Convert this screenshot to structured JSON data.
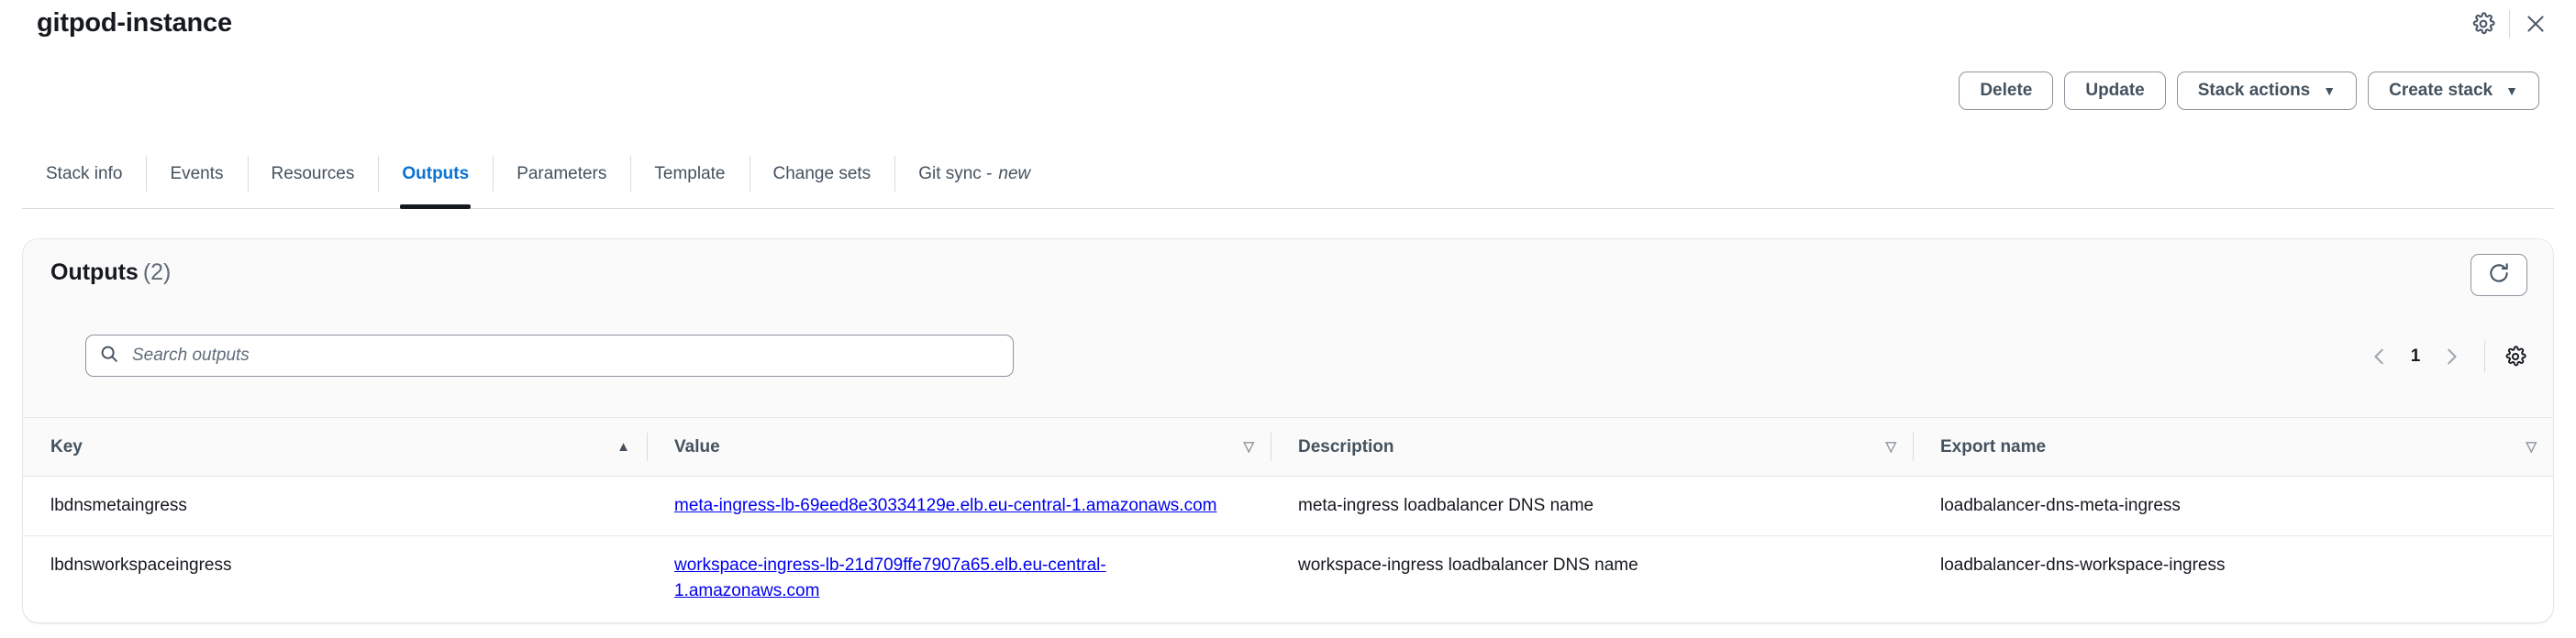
{
  "header": {
    "title": "gitpod-instance",
    "settings_icon": "gear-icon",
    "close_icon": "close-icon"
  },
  "actions": {
    "delete_label": "Delete",
    "update_label": "Update",
    "stack_actions_label": "Stack actions",
    "create_stack_label": "Create stack",
    "caret": "▼"
  },
  "tabs": [
    {
      "label": "Stack info",
      "active": false
    },
    {
      "label": "Events",
      "active": false
    },
    {
      "label": "Resources",
      "active": false
    },
    {
      "label": "Outputs",
      "active": true
    },
    {
      "label": "Parameters",
      "active": false
    },
    {
      "label": "Template",
      "active": false
    },
    {
      "label": "Change sets",
      "active": false
    },
    {
      "label": "Git sync -",
      "badge": "new",
      "active": false
    }
  ],
  "panel": {
    "title": "Outputs",
    "count": "(2)",
    "refresh_icon": "refresh-icon",
    "search": {
      "placeholder": "Search outputs",
      "value": "",
      "icon": "search-icon"
    },
    "pagination": {
      "prev": "‹",
      "page": "1",
      "next": "›",
      "preferences_icon": "gear-icon"
    },
    "table": {
      "columns": [
        {
          "label": "Key",
          "sort": "▲",
          "sorted": true
        },
        {
          "label": "Value",
          "sort": "▽",
          "sorted": false
        },
        {
          "label": "Description",
          "sort": "▽",
          "sorted": false
        },
        {
          "label": "Export name",
          "sort": "▽",
          "sorted": false
        }
      ],
      "rows": [
        {
          "key": "lbdnsmetaingress",
          "value": "meta-ingress-lb-69eed8e30334129e.elb.eu-central-1.amazonaws.com",
          "description": "meta-ingress loadbalancer DNS name",
          "export_name": "loadbalancer-dns-meta-ingress"
        },
        {
          "key": "lbdnsworkspaceingress",
          "value": "workspace-ingress-lb-21d709ffe7907a65.elb.eu-central-1.amazonaws.com",
          "description": "workspace-ingress loadbalancer DNS name",
          "export_name": "loadbalancer-dns-workspace-ingress"
        }
      ]
    }
  },
  "colors": {
    "accent": "#0972d3",
    "link": "#0000ee",
    "text": "#16191f",
    "muted": "#5f6b7a",
    "border": "#d7dbdd"
  }
}
